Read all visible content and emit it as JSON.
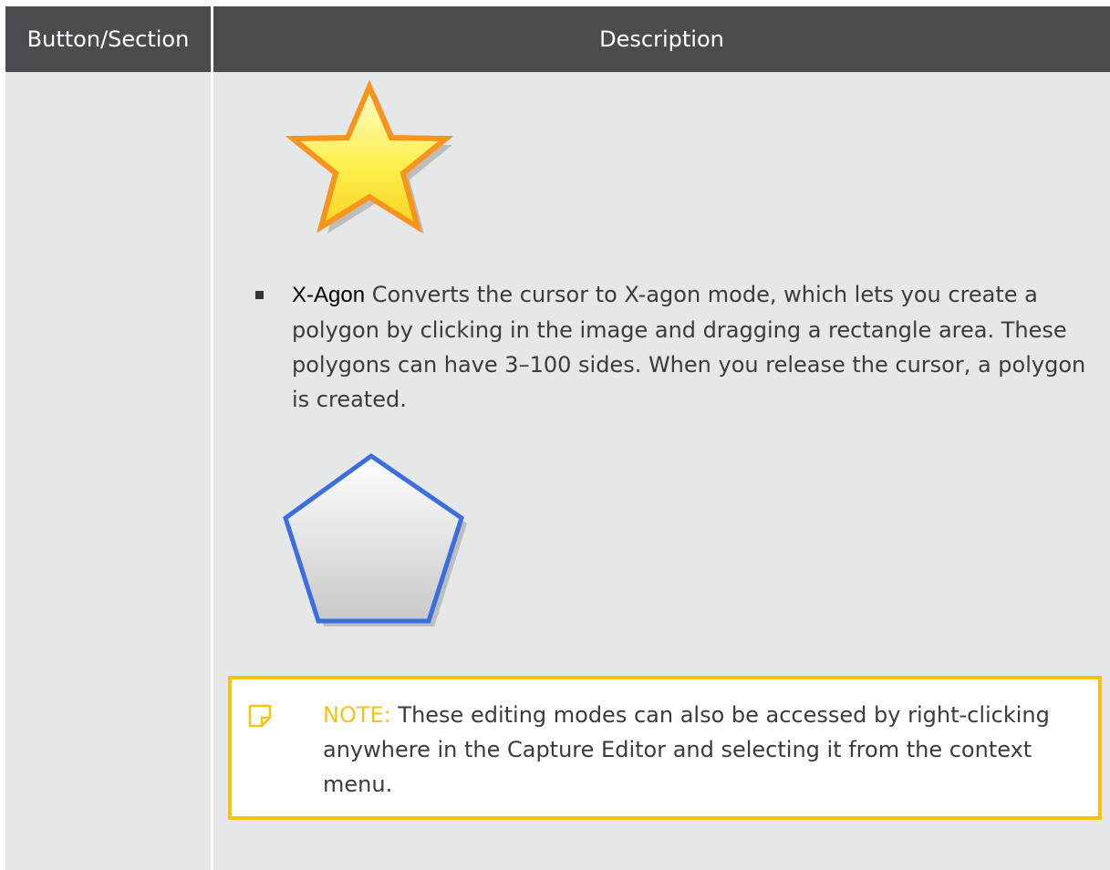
{
  "table": {
    "header_left": "Button/Section",
    "header_right": "Description"
  },
  "xagon": {
    "term": "X-Agon",
    "description": "Converts the cursor to X-agon mode, which lets you create a polygon by clicking in the image and dragging a rectangle area. These polygons can have 3–100 sides. When you release the cursor, a polygon is created."
  },
  "note": {
    "label": "NOTE:",
    "text": "These editing modes can also be accessed by right-clicking anywhere in the Capture Editor and selecting it from the context menu."
  },
  "illustrations": {
    "star": "star-shape",
    "pentagon": "pentagon-shape",
    "note_icon": "note-icon"
  },
  "colors": {
    "header_bg": "#494b4e",
    "body_bg": "#e6e7e8",
    "note_border": "#f6c313",
    "star_fill": "#fce94f",
    "star_stroke": "#f7941d",
    "pentagon_stroke": "#3b6fe0"
  }
}
